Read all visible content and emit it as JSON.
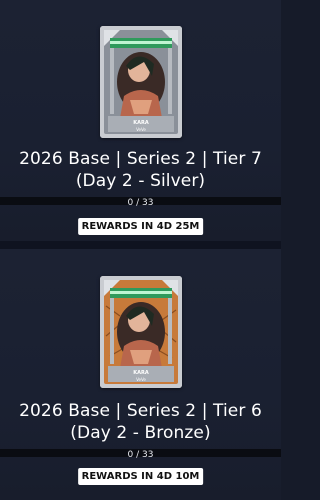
{
  "sets": [
    {
      "title": "2026 Base | Series 2 | Tier 7 (Day 2 - Silver)",
      "progress_label": "0 / 33",
      "progress_fraction": 0,
      "rewards_label": "REWARDS IN 4D 25M",
      "card_name": "KARA",
      "card_brand": "VeVe",
      "tier_color": "silver",
      "card_frame_color": "#c9ccd1",
      "card_bg_color": "#8a9099"
    },
    {
      "title": "2026 Base | Series 2 | Tier 6 (Day 2 - Bronze)",
      "progress_label": "0 / 33",
      "progress_fraction": 0,
      "rewards_label": "REWARDS IN 4D 10M",
      "card_name": "KARA",
      "card_brand": "VeVe",
      "tier_color": "bronze",
      "card_frame_color": "#c9ccd1",
      "card_bg_color": "#c77a3a"
    }
  ]
}
